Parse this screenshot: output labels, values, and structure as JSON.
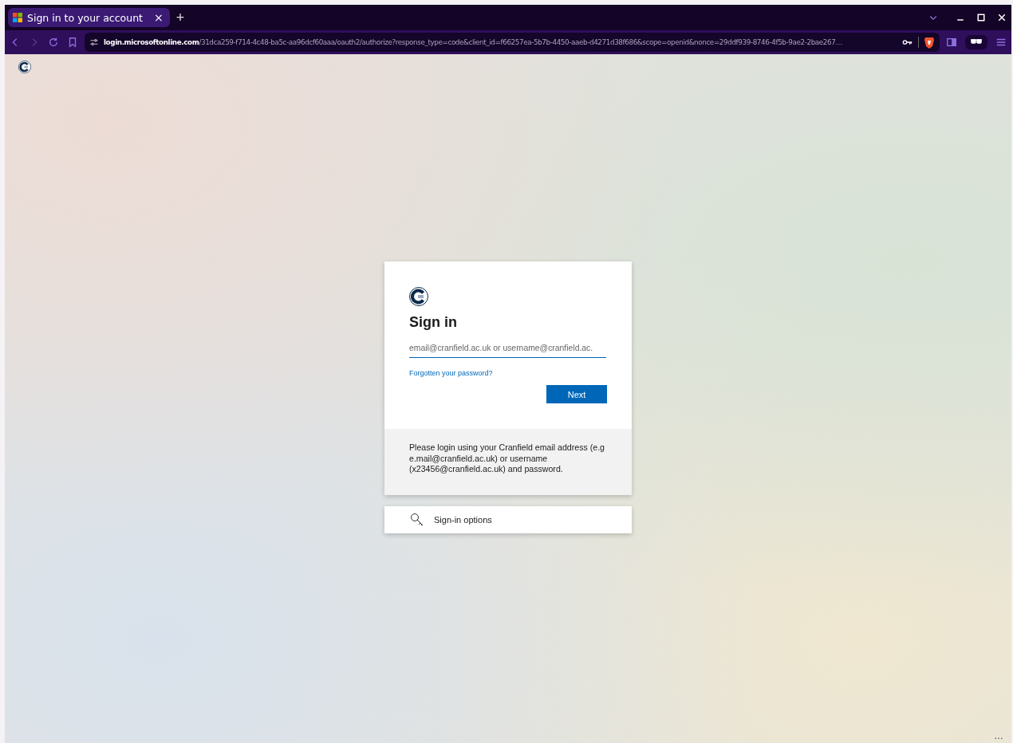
{
  "tabs": [
    {
      "title": "Sign in to your account",
      "selected": true,
      "close": "×"
    }
  ],
  "new_tab": "+",
  "address_bar": {
    "host": "login.microsoftonline.com",
    "path": "/31dca259-f714-4c48-ba5c-aa96dcf60aaa/oauth2/authorize?response_type=code&client_id=f66257ea-5b7b-4450-aaeb-d4271d38f686&scope=openid&nonce=29ddf939-8746-4f5b-9ae2-2bae267…"
  },
  "card": {
    "title": "Sign in",
    "email_field": {
      "placeholder": "email@cranfield.ac.uk or username@cranfield.ac."
    },
    "forgot_link": "Forgotten your password?",
    "next_button": "Next",
    "help_text": "Please login using your Cranfield email address (e.g e.mail@cranfield.ac.uk) or username (x23456@cranfield.ac.uk) and password."
  },
  "options_button": "Sign-in options",
  "overflow_menu": "…"
}
